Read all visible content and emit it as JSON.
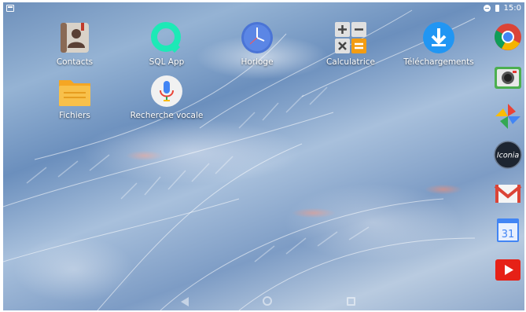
{
  "status_bar": {
    "time": "15:0",
    "left_icon": "notification-image-icon",
    "right_icons": [
      "sync-icon",
      "battery-icon"
    ]
  },
  "home_apps": [
    {
      "label": "Contacts",
      "icon": "contacts-icon"
    },
    {
      "label": "SQL App",
      "icon": "sql-app-icon"
    },
    {
      "label": "Horloge",
      "icon": "clock-icon"
    },
    {
      "label": "Calculatrice",
      "icon": "calculator-icon"
    },
    {
      "label": "Téléchargements",
      "icon": "download-icon"
    },
    {
      "label": "Fichiers",
      "icon": "folder-icon"
    },
    {
      "label": "Recherche vocale",
      "icon": "microphone-icon"
    }
  ],
  "dock": {
    "apps": [
      {
        "name": "Chrome",
        "icon": "chrome-icon"
      },
      {
        "name": "Camera",
        "icon": "camera-icon"
      },
      {
        "name": "Photos",
        "icon": "pinwheel-icon"
      },
      {
        "name": "Iconia",
        "icon": "iconia-icon",
        "text": "Iconia"
      },
      {
        "name": "Gmail",
        "icon": "gmail-icon"
      },
      {
        "name": "Agenda",
        "icon": "calendar-icon",
        "text": "31"
      },
      {
        "name": "YouTube",
        "icon": "youtube-icon"
      }
    ]
  },
  "nav_bar": {
    "buttons": [
      "back-icon",
      "home-icon",
      "recents-icon"
    ]
  },
  "colors": {
    "wallpaper_base": "#7d9cc5",
    "label_text": "#ffffff",
    "chrome_red": "#db4437",
    "chrome_yellow": "#f4b400",
    "chrome_green": "#0f9d58",
    "chrome_blue": "#4285f4",
    "youtube_red": "#e62117",
    "download_blue": "#2196f3",
    "sql_teal": "#1de9b6"
  }
}
